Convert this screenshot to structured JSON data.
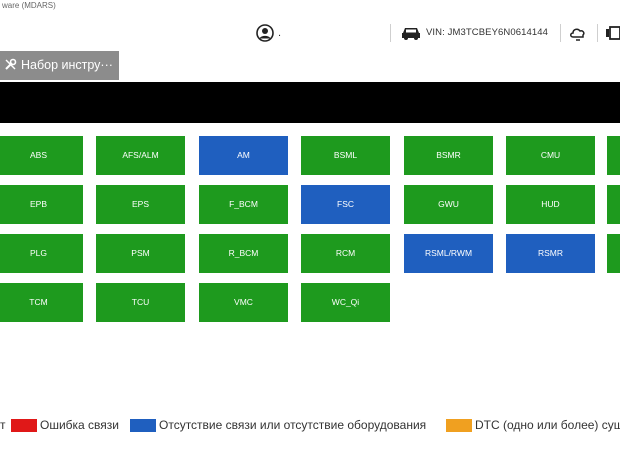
{
  "window": {
    "title": "ware (MDARS)"
  },
  "header": {
    "user_name": ".",
    "vin_label": "VIN: JM3TCBEY6N0614144"
  },
  "toolbar": {
    "toolset_label": "Набор инстру···"
  },
  "modules": [
    {
      "label": "ABS",
      "status": "green"
    },
    {
      "label": "AFS/ALM",
      "status": "green"
    },
    {
      "label": "AM",
      "status": "blue"
    },
    {
      "label": "BSML",
      "status": "green"
    },
    {
      "label": "BSMR",
      "status": "green"
    },
    {
      "label": "CMU",
      "status": "green"
    },
    {
      "label": "",
      "status": "green"
    },
    {
      "label": "EPB",
      "status": "green"
    },
    {
      "label": "EPS",
      "status": "green"
    },
    {
      "label": "F_BCM",
      "status": "green"
    },
    {
      "label": "FSC",
      "status": "blue"
    },
    {
      "label": "GWU",
      "status": "green"
    },
    {
      "label": "HUD",
      "status": "green"
    },
    {
      "label": "",
      "status": "green"
    },
    {
      "label": "PLG",
      "status": "green"
    },
    {
      "label": "PSM",
      "status": "green"
    },
    {
      "label": "R_BCM",
      "status": "green"
    },
    {
      "label": "RCM",
      "status": "green"
    },
    {
      "label": "RSML/RWM",
      "status": "blue"
    },
    {
      "label": "RSMR",
      "status": "blue"
    },
    {
      "label": "",
      "status": "green"
    },
    {
      "label": "TCM",
      "status": "green"
    },
    {
      "label": "TCU",
      "status": "green"
    },
    {
      "label": "VMC",
      "status": "green"
    },
    {
      "label": "WC_Qi",
      "status": "green"
    }
  ],
  "legend": {
    "item0": "т",
    "item1": "Ошибка связи",
    "item2": "Отсутствие связи или отсутствие оборудования",
    "item3": "DTC (одно или более) сущ",
    "colors": {
      "error": "#e01818",
      "no_comm": "#1f5fbf",
      "dtc": "#f0a020"
    }
  },
  "colors": {
    "green": "#1e9a1e",
    "blue": "#1f5fbf"
  }
}
